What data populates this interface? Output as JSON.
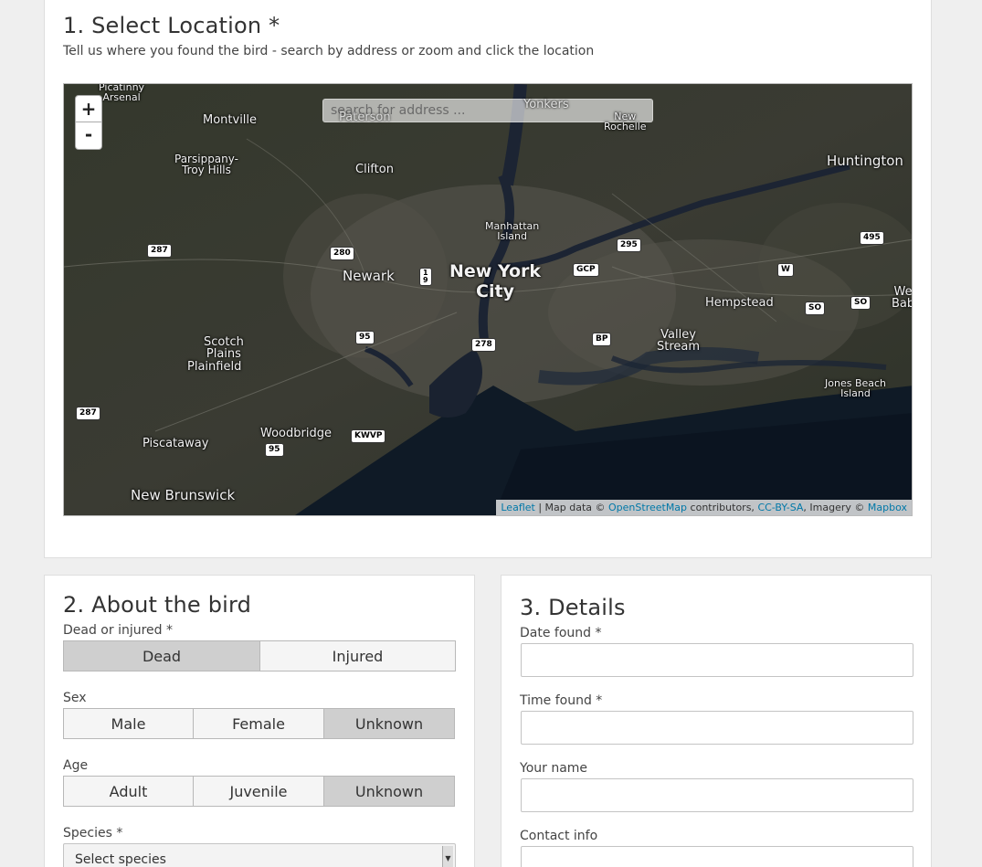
{
  "location": {
    "title": "1. Select Location *",
    "subtitle": "Tell us where you found the bird - search by address or zoom and click the location",
    "map": {
      "zoom_in": "+",
      "zoom_out": "-",
      "search_placeholder": "search for address ...",
      "places": {
        "picatinny": "Picatinny\nArsenal",
        "montville": "Montville",
        "paterson": "Paterson",
        "yonkers": "Yonkers",
        "new_rochelle": "New\nRochelle",
        "parsippany": "Parsippany-\nTroy Hills",
        "clifton": "Clifton",
        "huntington": "Huntington",
        "manhattan": "Manhattan\nIsland",
        "newark": "Newark",
        "nyc": "New York\nCity",
        "hempstead": "Hempstead",
        "west_babylon": "We\nBab",
        "scotch_plains": "Scotch\nPlains",
        "plainfield": "Plainfield",
        "valley_stream": "Valley\nStream",
        "jones_beach": "Jones Beach\nIsland",
        "woodbridge": "Woodbridge",
        "piscataway": "Piscataway",
        "new_brunswick": "New Brunswick"
      },
      "shields": {
        "s287a": "287",
        "s280": "280",
        "s19": "1\n9",
        "sgcp": "GCP",
        "s295": "295",
        "s495": "495",
        "sw": "W",
        "sso1": "SO",
        "sso2": "SO",
        "s95a": "95",
        "s278": "278",
        "sbp": "BP",
        "s287b": "287",
        "skwvp": "KWVP",
        "s95b": "95"
      },
      "attribution": {
        "leaflet": "Leaflet",
        "sep1": " | Map data © ",
        "osm": "OpenStreetMap",
        "mid": " contributors, ",
        "license": "CC-BY-SA",
        "imagery": ", Imagery © ",
        "mapbox": "Mapbox"
      }
    }
  },
  "bird": {
    "title": "2. About the bird",
    "dead_or_injured_label": "Dead or injured *",
    "dead_or_injured": {
      "options": [
        "Dead",
        "Injured"
      ],
      "selected": "Dead"
    },
    "sex_label": "Sex",
    "sex": {
      "options": [
        "Male",
        "Female",
        "Unknown"
      ],
      "selected": "Unknown"
    },
    "age_label": "Age",
    "age": {
      "options": [
        "Adult",
        "Juvenile",
        "Unknown"
      ],
      "selected": "Unknown"
    },
    "species_label": "Species *",
    "species_value": "Select species"
  },
  "details": {
    "title": "3. Details",
    "date_label": "Date found *",
    "date_value": "",
    "time_label": "Time found *",
    "time_value": "",
    "name_label": "Your name",
    "name_value": "",
    "contact_label": "Contact info",
    "contact_value": ""
  }
}
